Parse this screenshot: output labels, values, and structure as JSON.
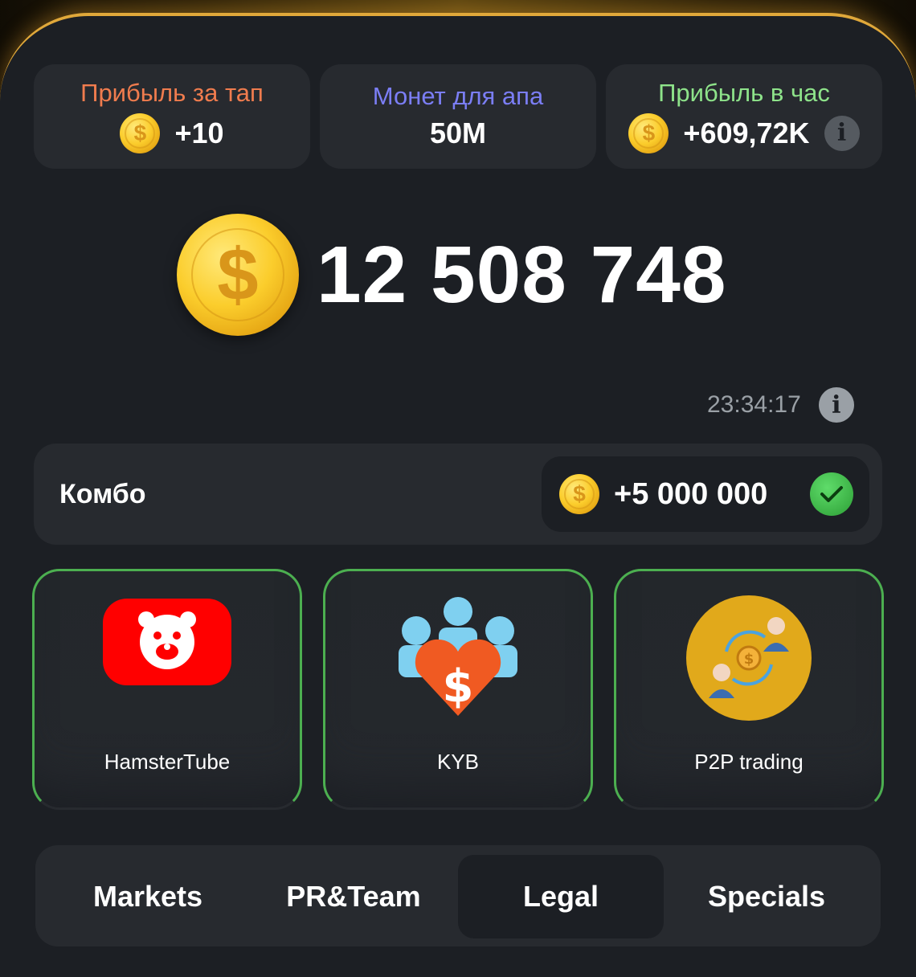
{
  "stats": [
    {
      "label": "Прибыль за тап",
      "value": "+10",
      "color": "#f07c4e",
      "icon": "coin-icon"
    },
    {
      "label": "Монет для апа",
      "value": "50M",
      "color": "#7b7ef5",
      "icon": ""
    },
    {
      "label": "Прибыль в час",
      "value": "+609,72K",
      "color": "#8ee38a",
      "icon": "coin-icon",
      "info": "i"
    }
  ],
  "balance": {
    "value": "12 508 748",
    "coin_symbol": "$"
  },
  "timer": {
    "value": "23:34:17",
    "info": "i"
  },
  "combo": {
    "label": "Комбо",
    "reward": "+5 000 000",
    "coin_symbol": "$",
    "status": "completed"
  },
  "cards": [
    {
      "label": "HamsterTube",
      "icon": "hamstertube-icon"
    },
    {
      "label": "KYB",
      "icon": "kyb-icon"
    },
    {
      "label": "P2P trading",
      "icon": "p2p-trading-icon"
    }
  ],
  "tabs": {
    "items": [
      {
        "label": "Markets"
      },
      {
        "label": "PR&Team"
      },
      {
        "label": "Legal"
      },
      {
        "label": "Specials"
      }
    ],
    "active": "Legal"
  },
  "colors": {
    "panel": "#1c1f24",
    "card": "#272a2f",
    "accent_border": "#4caf50",
    "gold": "#fbcd2c"
  }
}
